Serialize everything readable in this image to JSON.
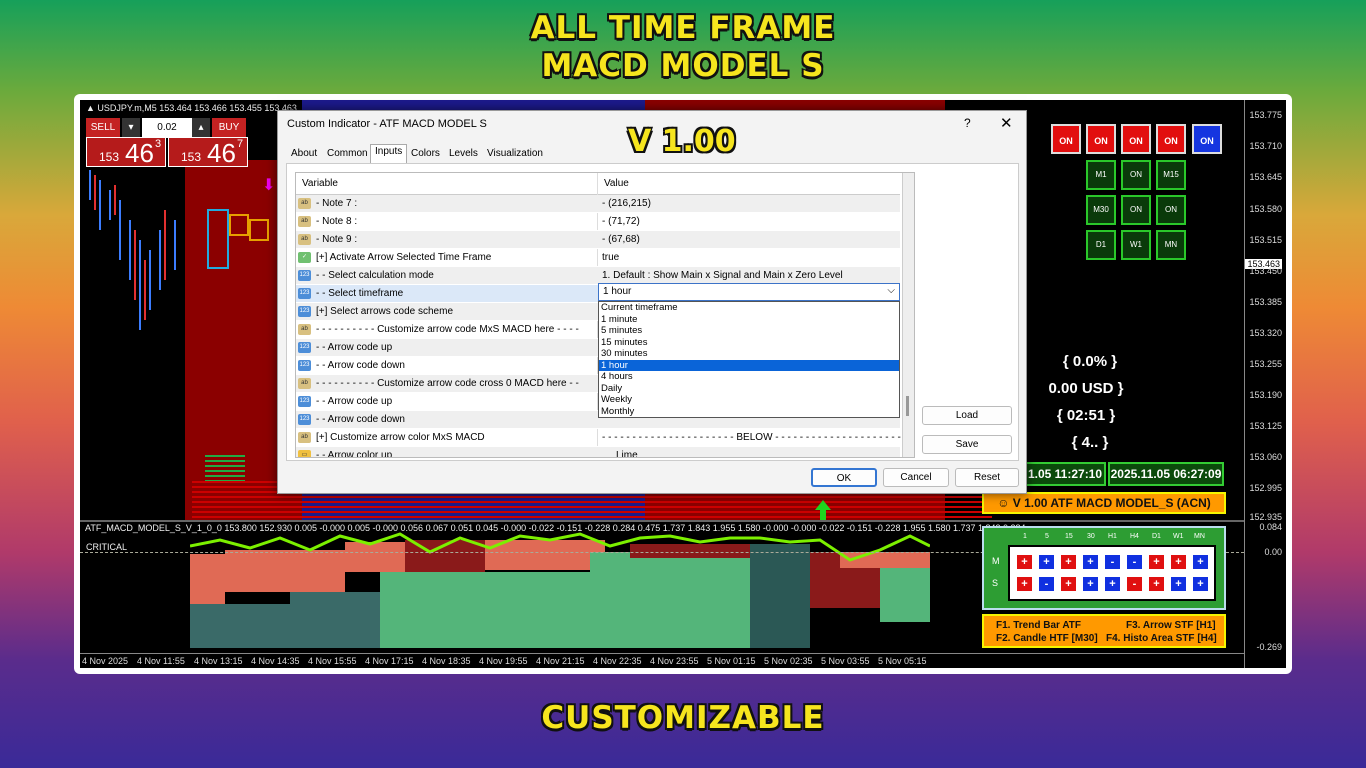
{
  "banner": {
    "line1": "ALL TIME FRAME",
    "line2": "MACD MODEL S",
    "version": "V 1.00",
    "bottom": "CUSTOMIZABLE"
  },
  "terminal": {
    "symbol_line": "▲ USDJPY.m,M5  153.464 153.466 153.455 153.463",
    "sell_label": "SELL",
    "buy_label": "BUY",
    "lot": "0.02",
    "sell_price_small": "153",
    "sell_price_big": "46",
    "sell_price_sup": "3",
    "buy_price_small": "153",
    "buy_price_big": "46",
    "buy_price_sup": "7",
    "price_axis": [
      "153.775",
      "153.710",
      "153.645",
      "153.580",
      "153.515",
      "153.450",
      "153.385",
      "153.320",
      "153.255",
      "153.190",
      "153.125",
      "153.060",
      "152.995",
      "152.935"
    ],
    "current_price": "153.463",
    "indicator_axis": [
      "0.084",
      "0.00",
      "-0.269"
    ],
    "time_axis": [
      "4 Nov 2025",
      "4 Nov 11:55",
      "4 Nov 13:15",
      "4 Nov 14:35",
      "4 Nov 15:55",
      "4 Nov 17:15",
      "4 Nov 18:35",
      "4 Nov 19:55",
      "4 Nov 21:15",
      "4 Nov 22:35",
      "4 Nov 23:55",
      "5 Nov 01:15",
      "5 Nov 02:35",
      "5 Nov 03:55",
      "5 Nov 05:15"
    ],
    "indicator_title": "ATF_MACD_MODEL_S_V_1_0_0 153.800 152.930 0.005 -0.000 0.005 -0.000 0.056 0.067 0.051 0.045 -0.000 -0.022 -0.151 -0.228 0.284 0.475 1.737 1.843 1.955 1.580 -0.000 -0.000 -0.022 -0.151 -0.228 1.955 1.580 1.737 1.843 0.284",
    "critical_label": "CRITICAL"
  },
  "panel": {
    "on_row": [
      "ON",
      "ON",
      "ON",
      "ON",
      "ON"
    ],
    "tf_row1": [
      "M1",
      "ON",
      "M15"
    ],
    "tf_row2": [
      "M30",
      "ON",
      "ON"
    ],
    "tf_row3": [
      "D1",
      "W1",
      "MN"
    ],
    "percent": "{ 0.0% }",
    "usd": "0.00 USD }",
    "timer": "{ 02:51 }",
    "count": "{ 4.. }",
    "date1": "1.05 11:27:10",
    "date2": "2025.11.05 06:27:09",
    "model_label": "☺  V 1.00 ATF MACD MODEL_S (ACN)",
    "grid_headers": [
      "1",
      "5",
      "15",
      "30",
      "H1",
      "H4",
      "D1",
      "W1",
      "MN"
    ],
    "grid_row_labels": [
      "M",
      "S"
    ],
    "grid_m": [
      "+",
      "+",
      "+",
      "+",
      "-",
      "-",
      "+",
      "+",
      "+"
    ],
    "grid_s": [
      "+",
      "-",
      "+",
      "+",
      "+",
      "-",
      "+",
      "+",
      "+"
    ],
    "fkey1": "F1. Trend Bar ATF",
    "fkey2": "F2. Candle HTF [M30]",
    "fkey3": "F3. Arrow STF [H1]",
    "fkey4": "F4. Histo Area STF [H4]",
    "colors": {
      "on_red": "#e20e0e",
      "on_blue": "#1535e0",
      "green": "#2d9d33",
      "orange": "#ff9900"
    }
  },
  "dialog": {
    "title": "Custom Indicator - ATF MACD MODEL S",
    "help": "?",
    "close": "✕",
    "tabs": [
      "About",
      "Common",
      "Inputs",
      "Colors",
      "Levels",
      "Visualization"
    ],
    "col_variable": "Variable",
    "col_value": "Value",
    "rows": [
      {
        "icon": "ab",
        "name": "- Note 7 :",
        "value": "- (216,215)"
      },
      {
        "icon": "ab",
        "name": "- Note 8 :",
        "value": "- (71,72)"
      },
      {
        "icon": "ab",
        "name": "- Note 9 :",
        "value": "- (67,68)"
      },
      {
        "icon": "ck",
        "name": "[+] Activate Arrow Selected Time Frame",
        "value": "true"
      },
      {
        "icon": "123",
        "name": "- - Select calculation mode",
        "value": "1. Default : Show Main x Signal and Main x Zero Level"
      },
      {
        "icon": "123",
        "name": "- - Select timeframe",
        "value": ""
      },
      {
        "icon": "123",
        "name": "[+] Select arrows code scheme",
        "value": ""
      },
      {
        "icon": "ab",
        "name": "- - - - - - - - - - Customize arrow code MxS MACD here - - - -",
        "value": ""
      },
      {
        "icon": "123",
        "name": "- - Arrow code up",
        "value": ""
      },
      {
        "icon": "123",
        "name": "- - Arrow code down",
        "value": ""
      },
      {
        "icon": "ab",
        "name": "- - - - - - - - - - Customize arrow code cross 0 MACD here - -",
        "value": ""
      },
      {
        "icon": "123",
        "name": "- - Arrow code up",
        "value": ""
      },
      {
        "icon": "123",
        "name": "- - Arrow code down",
        "value": ""
      },
      {
        "icon": "ab",
        "name": "[+] Customize arrow color MxS MACD",
        "value": "- - - - - - - - - - - - - - - - - - - - - - BELOW - - - - - - - - - - - - - - - - - - - - - -"
      },
      {
        "icon": "col",
        "name": "- - Arrow color up",
        "value": "Lime"
      }
    ],
    "selected_value": "1 hour",
    "dropdown": [
      "Current timeframe",
      "1 minute",
      "5 minutes",
      "15 minutes",
      "30 minutes",
      "1 hour",
      "4 hours",
      "Daily",
      "Weekly",
      "Monthly"
    ],
    "dropdown_selected_index": 5,
    "load": "Load",
    "save": "Save",
    "ok": "OK",
    "cancel": "Cancel",
    "reset": "Reset"
  }
}
